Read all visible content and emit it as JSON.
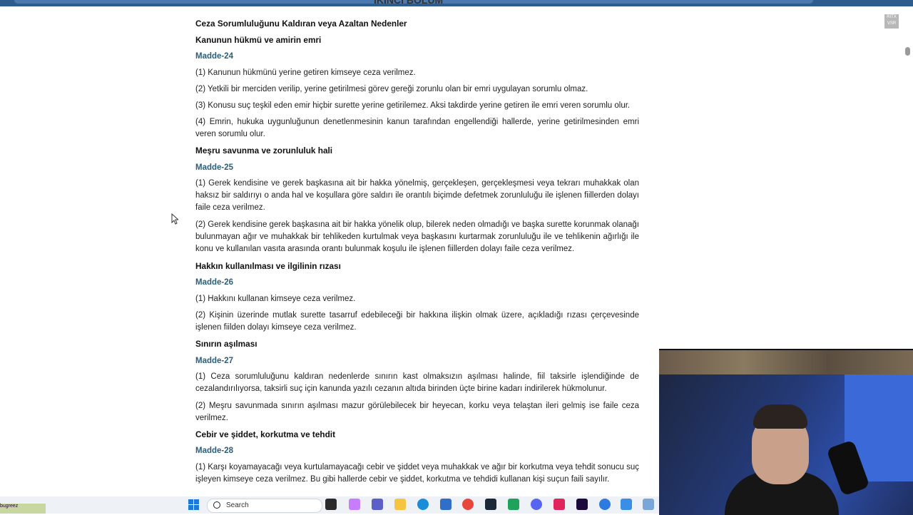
{
  "document": {
    "part_title": "İKİNCİ BÖLÜM",
    "section_title": "Ceza Sorumluluğunu Kaldıran veya Azaltan Nedenler",
    "articles": [
      {
        "heading": "Kanunun hükmü ve amirin emri",
        "madde": "Madde-24",
        "paragraphs": [
          "(1) Kanunun hükmünü yerine getiren kimseye ceza verilmez.",
          "(2) Yetkili bir merciden verilip, yerine getirilmesi görev gereği zorunlu olan bir emri uygulayan sorumlu olmaz.",
          "(3) Konusu suç teşkil eden emir hiçbir surette yerine getirilemez. Aksi takdirde yerine getiren ile emri veren sorumlu olur.",
          "(4) Emrin, hukuka uygunluğunun denetlenmesinin kanun tarafından engellendiği hallerde, yerine getirilmesinden emri veren sorumlu olur."
        ]
      },
      {
        "heading": "Meşru savunma ve zorunluluk hali",
        "madde": "Madde-25",
        "paragraphs": [
          "(1) Gerek kendisine ve gerek başkasına ait bir hakka yönelmiş, gerçekleşen, gerçekleşmesi veya tekrarı muhakkak olan haksız bir saldırıyı o anda hal ve koşullara göre saldırı ile orantılı biçimde defetmek zorunluluğu ile işlenen fiillerden dolayı faile ceza verilmez.",
          "(2) Gerek kendisine gerek başkasına ait bir hakka yönelik olup, bilerek neden olmadığı ve başka surette korunmak olanağı bulunmayan ağır ve muhakkak bir tehlikeden kurtulmak veya başkasını kurtarmak zorunluluğu ile ve tehlikenin ağırlığı ile konu ve kullanılan vasıta arasında orantı bulunmak koşulu ile işlenen fiillerden dolayı faile ceza verilmez."
        ]
      },
      {
        "heading": "Hakkın kullanılması ve ilgilinin rızası",
        "madde": "Madde-26",
        "paragraphs": [
          "(1) Hakkını kullanan kimseye ceza verilmez.",
          "(2) Kişinin üzerinde mutlak surette tasarruf edebileceği bir hakkına ilişkin olmak üzere, açıkladığı rızası çerçevesinde işlenen fiilden dolayı kimseye ceza verilmez."
        ]
      },
      {
        "heading": "Sınırın aşılması",
        "madde": "Madde-27",
        "paragraphs": [
          "(1) Ceza sorumluluğunu kaldıran nedenlerde sınırın kast olmaksızın aşılması halinde, fiil taksirle işlendiğinde de cezalandırılıyorsa, taksirli suç için kanunda yazılı cezanın altıda birinden üçte birine kadarı indirilerek hükmolunur.",
          "(2) Meşru savunmada sınırın aşılması mazur görülebilecek bir heyecan, korku veya telaştan ileri gelmiş ise faile ceza verilmez."
        ]
      },
      {
        "heading": "Cebir ve şiddet, korkutma ve tehdit",
        "madde": "Madde-28",
        "paragraphs": [
          "(1) Karşı koyamayacağı veya kurtulamayacağı cebir ve şiddet veya muhakkak ve ağır bir korkutma veya tehdit sonucu suç işleyen kimseye ceza verilmez. Bu gibi hallerde cebir ve şiddet, korkutma ve tehdidi kullanan kişi suçun faili sayılır."
        ]
      }
    ]
  },
  "taskbar": {
    "search_placeholder": "Search",
    "left_label": "bugreez"
  },
  "overlay": {
    "badge_text": "RITX VSR"
  }
}
